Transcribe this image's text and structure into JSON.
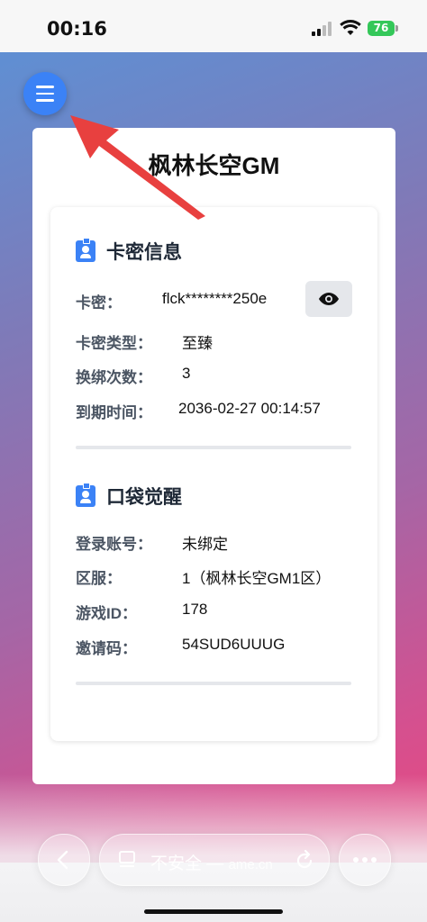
{
  "status_bar": {
    "time": "00:16",
    "battery": "76"
  },
  "page": {
    "menu_icon": "hamburger-menu-icon",
    "title": "枫林长空GM"
  },
  "card_section": {
    "title": "卡密信息",
    "icon": "id-badge-icon",
    "rows": [
      {
        "label": "卡密：",
        "value": "flck********250e"
      },
      {
        "label": "卡密类型：",
        "value": "至臻"
      },
      {
        "label": "换绑次数：",
        "value": "3"
      },
      {
        "label": "到期时间：",
        "value": "2036-02-27 00:14:57"
      }
    ],
    "reveal_icon": "eye-icon"
  },
  "game_section": {
    "title": "口袋觉醒",
    "icon": "id-badge-icon",
    "rows": [
      {
        "label": "登录账号：",
        "value": "未绑定"
      },
      {
        "label": "区服：",
        "value": "1（枫林长空GM1区）"
      },
      {
        "label": "游戏ID：",
        "value": "178"
      },
      {
        "label": "邀请码：",
        "value": "54SUD6UUUG"
      }
    ]
  },
  "browser_bar": {
    "insecure_label": "不安全 —",
    "domain": "ame.cn",
    "back_icon": "chevron-left-icon",
    "reload_icon": "reload-icon",
    "more_icon": "more-dots-icon",
    "tabs_icon": "page-icon"
  },
  "colors": {
    "accent": "#3b82f6",
    "arrow": "#e8403f"
  }
}
